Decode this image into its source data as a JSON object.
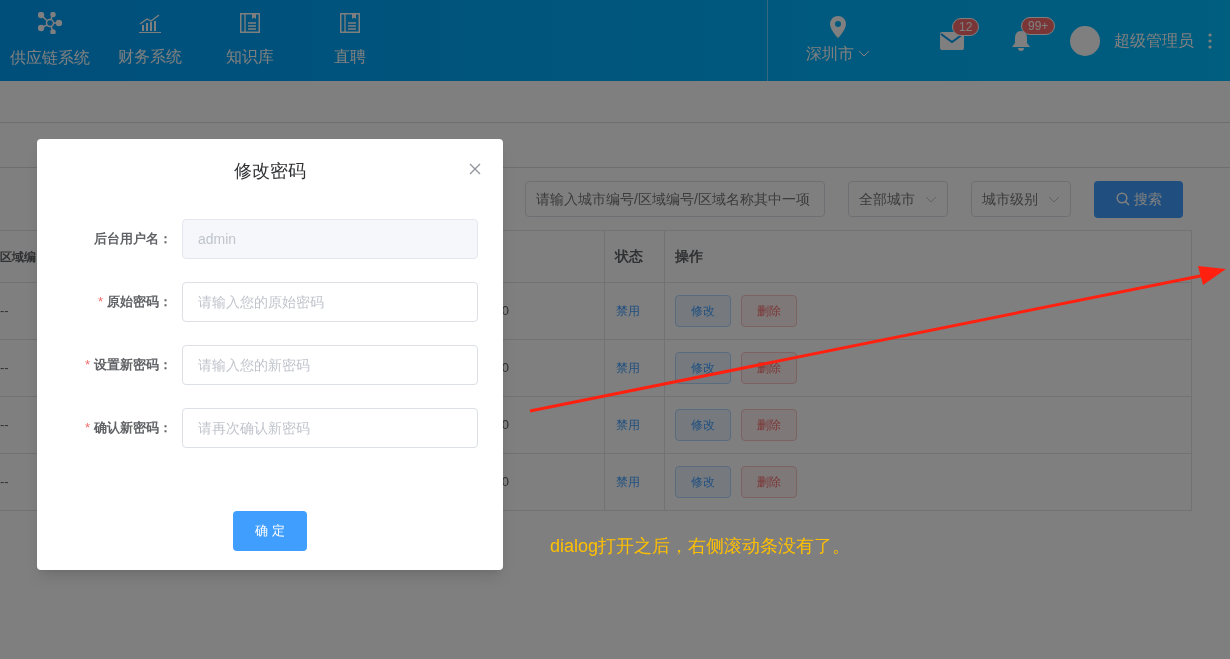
{
  "header": {
    "nav_items": [
      {
        "label": "供应链系统"
      },
      {
        "label": "财务系统"
      },
      {
        "label": "知识库"
      },
      {
        "label": "直聘"
      }
    ],
    "city": "深圳市",
    "mail_badge": "12",
    "bell_badge": "99+",
    "user": "超级管理员"
  },
  "filters": {
    "search_placeholder": "请输入城市编号/区域编号/区域名称其中一项",
    "selects": [
      "全部城市",
      "城市级别"
    ],
    "search_button": "搜索"
  },
  "table": {
    "columns": [
      "区域编",
      "状态",
      "操作"
    ],
    "rows": [
      {
        "area_code": "--",
        "column_2": "0",
        "status": "禁用",
        "actions": [
          "修改",
          "删除"
        ]
      },
      {
        "area_code": "--",
        "column_2": "0",
        "status": "禁用",
        "actions": [
          "修改",
          "删除"
        ]
      },
      {
        "area_code": "--",
        "column_2": "0",
        "status": "禁用",
        "actions": [
          "修改",
          "删除"
        ]
      },
      {
        "area_code": "--",
        "column_2": "0",
        "status": "禁用",
        "actions": [
          "修改",
          "删除"
        ]
      }
    ]
  },
  "dialog": {
    "title": "修改密码",
    "fields": [
      {
        "label": "后台用户名：",
        "kind": "readonly",
        "value": "admin"
      },
      {
        "label": "原始密码：",
        "kind": "input",
        "required_mark": "*",
        "placeholder": "请输入您的原始密码"
      },
      {
        "label": "设置新密码：",
        "kind": "input",
        "required_mark": "*",
        "placeholder": "请输入您的新密码"
      },
      {
        "label": "确认新密码：",
        "kind": "input",
        "required_mark": "*",
        "placeholder": "请再次确认新密码"
      }
    ],
    "confirm_button": "确 定"
  },
  "annotation": {
    "text": "dialog打开之后，右侧滚动条没有了。"
  }
}
